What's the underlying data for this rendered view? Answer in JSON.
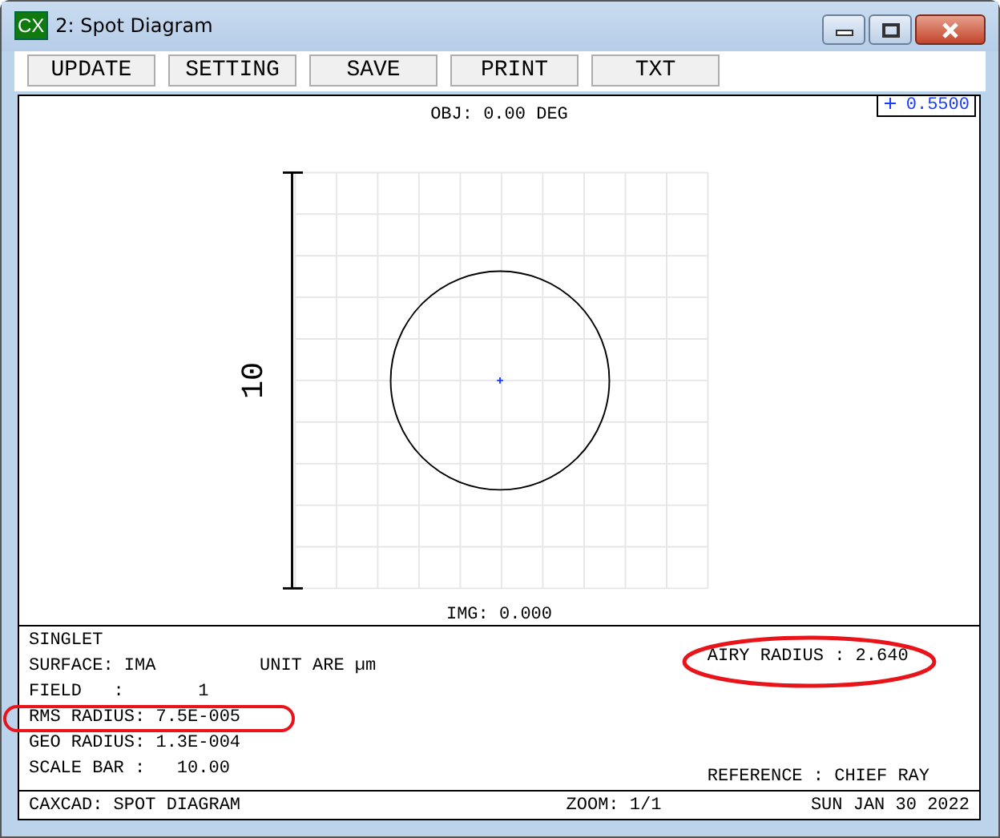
{
  "window": {
    "title": "2: Spot Diagram",
    "app_icon": "CX"
  },
  "toolbar": [
    "UPDATE",
    "SETTING",
    "SAVE",
    "PRINT",
    "TXT"
  ],
  "plot": {
    "object_label": "OBJ: 0.00 DEG",
    "image_label": "IMG: 0.000",
    "scale_label": "10",
    "legend": "0.5500"
  },
  "info": {
    "left": [
      "SINGLET",
      "SURFACE: IMA",
      "FIELD   :       1",
      "RMS RADIUS: 7.5E-005",
      "GEO RADIUS: 1.3E-004",
      "SCALE BAR :   10.00"
    ],
    "units": "UNIT ARE µm",
    "airy": "AIRY RADIUS : 2.640",
    "reference": "REFERENCE : CHIEF RAY"
  },
  "status_bar": {
    "left": "CAXCAD: SPOT DIAGRAM",
    "center": "ZOOM: 1/1",
    "right": "SUN JAN 30 2022"
  }
}
